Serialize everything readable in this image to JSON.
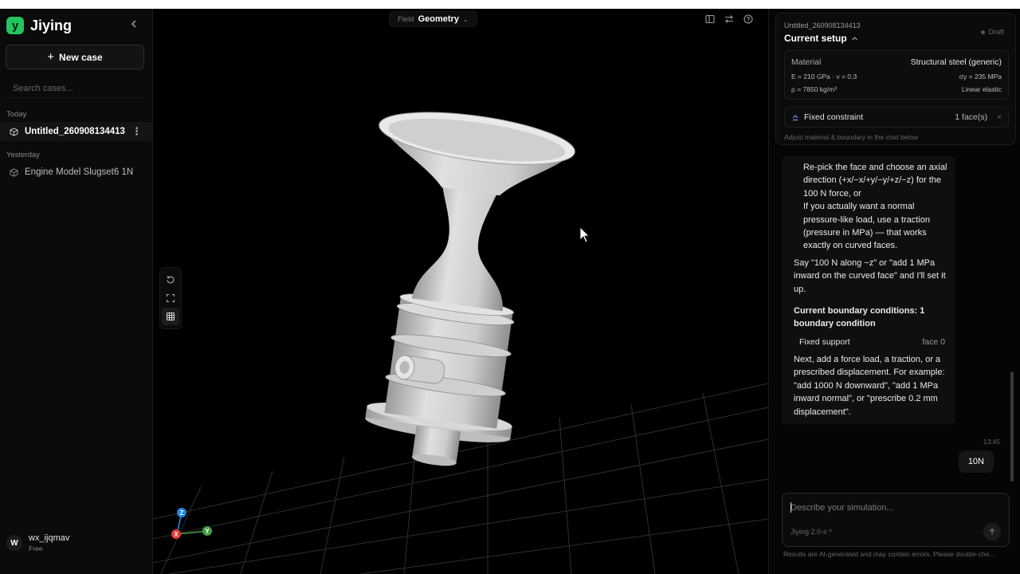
{
  "sidebar": {
    "brand": "Jiying",
    "logo_letter": "y",
    "new_case_label": "New case",
    "search_placeholder": "Search cases...",
    "groups": [
      {
        "label": "Today",
        "items": [
          {
            "name": "Untitled_260908134413",
            "active": true
          }
        ]
      },
      {
        "label": "Yesterday",
        "items": [
          {
            "name": "Engine Model Slugset6 1N",
            "active": false
          }
        ]
      }
    ],
    "user": {
      "avatar_letter": "W",
      "name": "wx_ijqmav",
      "plan": "Free"
    }
  },
  "viewport": {
    "field_label": "Field",
    "field_value": "Geometry",
    "axis_labels": {
      "z": "Z",
      "x": "X",
      "y": "Y"
    },
    "colors": {
      "model": "#d9d9d9",
      "grid": "#3a3a3a",
      "x_axis": "#e53935",
      "y_axis": "#43a047",
      "z_axis": "#1e88e5"
    }
  },
  "setup": {
    "case_name": "Untitled_260908134413",
    "title": "Current setup",
    "status": "Draft",
    "material": {
      "label": "Material",
      "name": "Structural steel (generic)",
      "left_1": "E = 210 GPa · ν = 0.3",
      "right_1": "σy = 235 MPa",
      "left_2": "ρ = 7850 kg/m³",
      "right_2": "Linear elastic"
    },
    "constraint": {
      "name": "Fixed constraint",
      "count": "1 face(s)"
    },
    "hint": "Adjust material & boundary in the chat below"
  },
  "chat": {
    "assistant": {
      "bullet_1": "Re-pick the face and choose an axial direction (+x/−x/+y/−y/+z/−z) for the 100 N force, or",
      "bullet_2": "If you actually want a normal pressure-like load, use a traction (pressure in MPa) — that works exactly on curved faces.",
      "para_1": "Say \"100 N along −z\" or \"add 1 MPa inward on the curved face\" and I'll set it up.",
      "heading": "Current boundary conditions: 1 boundary condition",
      "bc_name": "Fixed support",
      "bc_target": "face 0",
      "para_2": "Next, add a force load, a traction, or a prescribed displacement. For example: \"add 1000 N downward\", \"add 1 MPa inward normal\", or \"prescribe 0.2 mm displacement\"."
    },
    "timestamp": "13:45",
    "user_message": "10N"
  },
  "composer": {
    "placeholder": "Describe your simulation...",
    "model": "Jiying 2.0-s",
    "disclaimer": "Results are AI-generated and may contain errors. Please double-che..."
  }
}
